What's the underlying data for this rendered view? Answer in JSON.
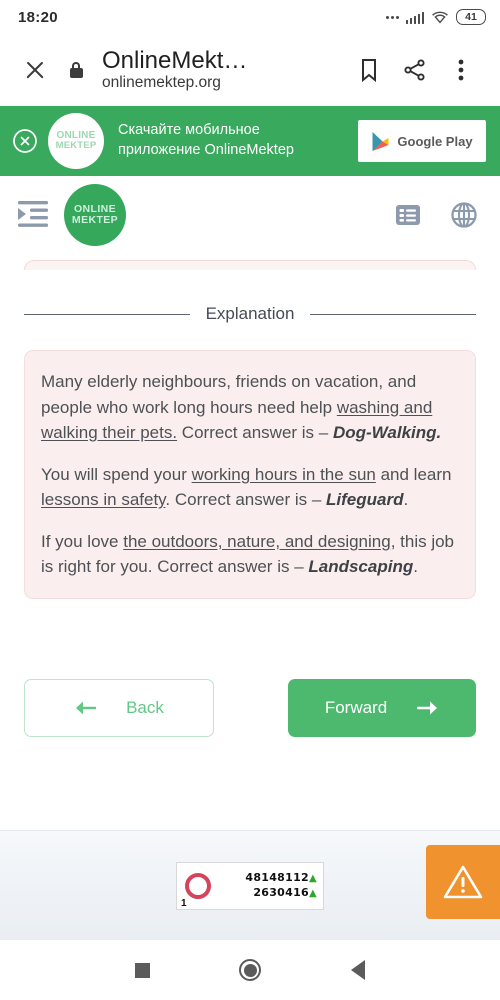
{
  "theme": {
    "brand_green": "#38a95d",
    "button_green": "#4cb96e",
    "card_pink_bg": "#fbeeee",
    "card_pink_border": "#f3dede",
    "warn_orange": "#f0922e",
    "icon_gray": "#8d9aab"
  },
  "status_bar": {
    "time": "18:20",
    "battery_level": "41",
    "icons": [
      "more-dots-icon",
      "cellular-signal-icon",
      "wifi-icon",
      "battery-icon"
    ]
  },
  "browser_bar": {
    "close_icon": "close-icon",
    "lock_icon": "lock-icon",
    "title": "OnlineMekt…",
    "url": "onlinemektep.org",
    "bookmark_icon": "bookmark-icon",
    "share_icon": "share-icon",
    "menu_icon": "more-vertical-icon"
  },
  "promo_banner": {
    "close_icon": "close-circle-icon",
    "logo_line1": "ONLINE",
    "logo_line2": "MEKTEP",
    "text_line1": "Скачайте мобильное",
    "text_line2": "приложение OnlineMektep",
    "store_button_label": "Google Play",
    "store_icon": "google-play-icon"
  },
  "site_nav": {
    "menu_icon": "format-indent-icon",
    "logo_line1": "ONLINE",
    "logo_line2": "MEKTEP",
    "list_icon": "list-view-icon",
    "language_icon": "globe-icon"
  },
  "main": {
    "section_divider_label": "Explanation",
    "explanation": [
      {
        "lead": "Many elderly neighbours, friends on vacation, and people who work long hours need help ",
        "underline": "washing and walking their pets.",
        "middle": " Correct answer is – ",
        "answer": "Dog-Walking.",
        "tail": ""
      },
      {
        "lead": "You will spend your ",
        "underline": "working hours in the sun",
        "middle": " and learn ",
        "underline2": "lessons in safety",
        "middle2": ". Correct answer is – ",
        "answer": "Lifeguard",
        "tail": "."
      },
      {
        "lead": "If you love ",
        "underline": "the outdoors, nature, and designing",
        "middle": ", this job is right for you. Correct answer is – ",
        "answer": "Landscaping",
        "tail": "."
      }
    ]
  },
  "footer_nav": {
    "back_label": "Back",
    "back_icon": "arrow-left-icon",
    "forward_label": "Forward",
    "forward_icon": "arrow-right-icon"
  },
  "ad": {
    "counter_index": "1",
    "counter_value_1": "48148112",
    "counter_value_2": "2630416",
    "trend_arrow": "▲",
    "warning_icon": "warning-triangle-icon"
  },
  "android_nav": {
    "recents_icon": "square-recents-icon",
    "home_icon": "circle-home-icon",
    "back_icon": "triangle-back-icon"
  }
}
